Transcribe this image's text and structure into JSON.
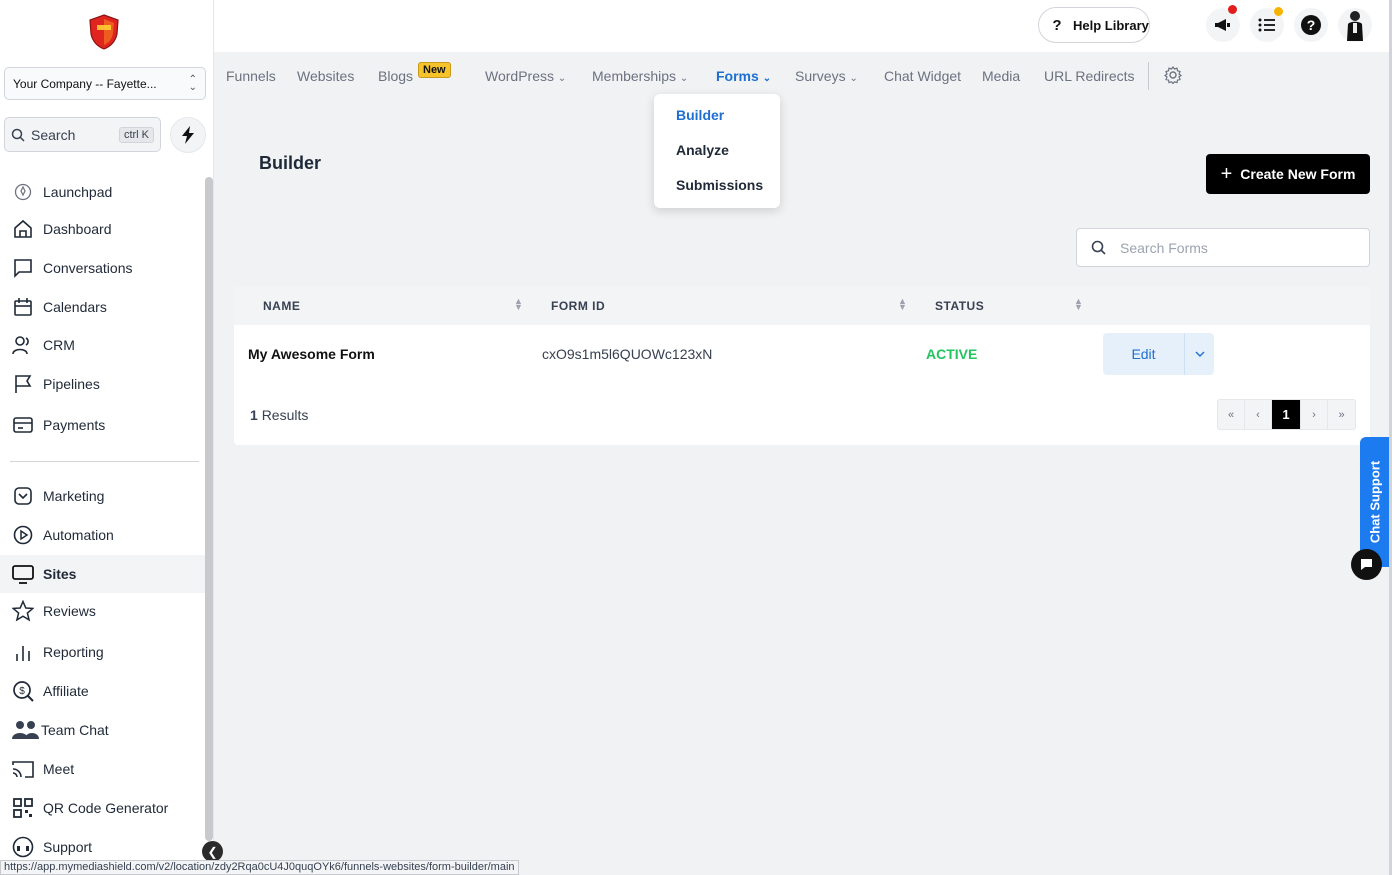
{
  "sidebar": {
    "company": "Your Company -- Fayette...",
    "search_label": "Search",
    "search_shortcut": "ctrl K",
    "items": [
      {
        "label": "Launchpad",
        "icon": "rocket-icon"
      },
      {
        "label": "Dashboard",
        "icon": "home-icon"
      },
      {
        "label": "Conversations",
        "icon": "chat-icon"
      },
      {
        "label": "Calendars",
        "icon": "calendar-icon"
      },
      {
        "label": "CRM",
        "icon": "contacts-icon"
      },
      {
        "label": "Pipelines",
        "icon": "flag-icon"
      },
      {
        "label": "Payments",
        "icon": "payment-card-icon"
      },
      {
        "label": "Marketing",
        "icon": "marketing-icon"
      },
      {
        "label": "Automation",
        "icon": "play-circle-icon"
      },
      {
        "label": "Sites",
        "icon": "monitor-icon"
      },
      {
        "label": "Reviews",
        "icon": "star-icon"
      },
      {
        "label": "Reporting",
        "icon": "bar-chart-icon"
      },
      {
        "label": "Affiliate",
        "icon": "affiliate-icon"
      },
      {
        "label": "Team Chat",
        "icon": "team-icon"
      },
      {
        "label": "Meet",
        "icon": "cast-icon"
      },
      {
        "label": "QR Code Generator",
        "icon": "qr-code-icon"
      },
      {
        "label": "Support",
        "icon": "headset-icon"
      }
    ]
  },
  "topbar": {
    "help_library": "Help Library",
    "help_q": "?"
  },
  "subnav": {
    "items": [
      "Funnels",
      "Websites",
      "Blogs",
      "WordPress",
      "Memberships",
      "Forms",
      "Surveys",
      "Chat Widget",
      "Media",
      "URL Redirects"
    ],
    "new_badge": "New",
    "active": "Forms"
  },
  "dropdown": {
    "items": [
      "Builder",
      "Analyze",
      "Submissions"
    ],
    "active": "Builder"
  },
  "main": {
    "title": "Builder",
    "create_button": "Create New Form",
    "search_placeholder": "Search Forms",
    "table": {
      "headers": [
        "NAME",
        "FORM ID",
        "STATUS"
      ],
      "rows": [
        {
          "name": "My Awesome Form",
          "form_id": "cxO9s1m5l6QUOWc123xN",
          "status": "ACTIVE",
          "action": "Edit"
        }
      ]
    },
    "results_count": "1",
    "results_label": "Results",
    "pagination": {
      "first": "«",
      "prev": "‹",
      "current": "1",
      "next": "›",
      "last": "»"
    }
  },
  "chat_support": "Chat Support",
  "status_url": "https://app.mymediashield.com/v2/location/zdy2Rqa0cU4J0quqOYk6/funnels-websites/form-builder/main",
  "colors": {
    "accent": "#1d6fd1",
    "active_status": "#22c55e",
    "chat_support": "#1d7bf0"
  }
}
